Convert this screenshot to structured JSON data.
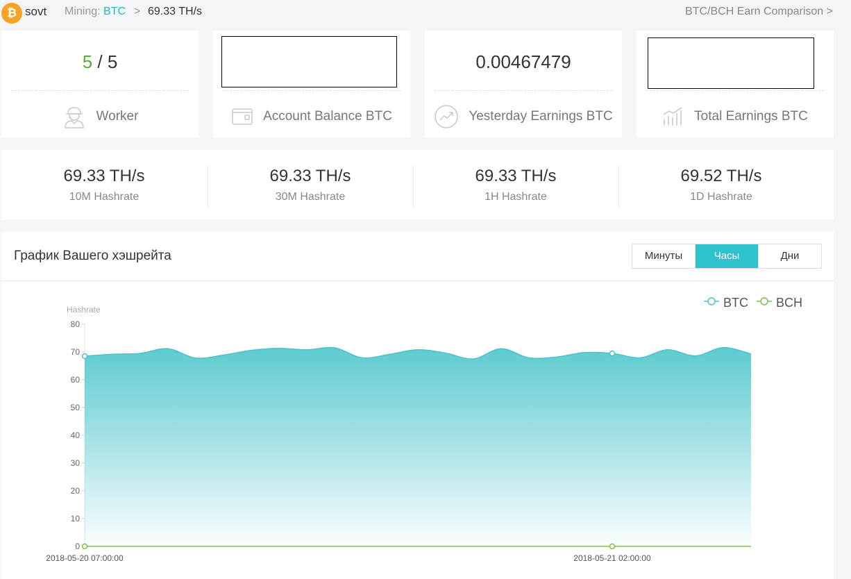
{
  "header": {
    "username": "sovt",
    "mining_label": "Mining: ",
    "coin": "BTC",
    "separator": ">",
    "current_rate": "69.33 TH/s",
    "compare_link": "BTC/BCH Earn Comparison >"
  },
  "cards": {
    "worker": {
      "active": "5",
      "sep": " / ",
      "total": "5",
      "label": "Worker",
      "icon": "worker-icon"
    },
    "balance": {
      "label": "Account Balance BTC",
      "icon": "wallet-icon"
    },
    "yesterday": {
      "value": "0.00467479",
      "label": "Yesterday Earnings BTC",
      "icon": "trend-icon"
    },
    "total": {
      "label": "Total Earnings BTC",
      "icon": "bar-chart-icon"
    }
  },
  "hashrates": [
    {
      "value": "69.33 TH/s",
      "label": "10M Hashrate"
    },
    {
      "value": "69.33 TH/s",
      "label": "30M Hashrate"
    },
    {
      "value": "69.33 TH/s",
      "label": "1H Hashrate"
    },
    {
      "value": "69.52 TH/s",
      "label": "1D Hashrate"
    }
  ],
  "chart_panel": {
    "title": "График Вашего хэшрейта",
    "tabs": [
      {
        "label": "Минуты",
        "active": false
      },
      {
        "label": "Часы",
        "active": true
      },
      {
        "label": "Дни",
        "active": false
      }
    ]
  },
  "colors": {
    "accent": "#2fc1cc",
    "btc_series": "#4cc3cc",
    "bch_series": "#7cc242",
    "coin": "#f7a325"
  },
  "chart_data": {
    "type": "area",
    "ylabel": "Hashrate",
    "ylim": [
      0,
      80
    ],
    "yticks": [
      0,
      10,
      20,
      30,
      40,
      50,
      60,
      70,
      80
    ],
    "x_tick_labels": [
      "2018-05-20 07:00:00",
      "2018-05-21 02:00:00"
    ],
    "x_tick_index": [
      0,
      19
    ],
    "legend_position": "top-right",
    "grid": false,
    "series": [
      {
        "name": "BTC",
        "color": "#4cc3cc",
        "values": [
          68.5,
          69.2,
          69.5,
          71.2,
          67.8,
          68.9,
          70.6,
          71.3,
          70.8,
          71.5,
          67.9,
          69.2,
          70.8,
          69.6,
          67.5,
          71.2,
          67.9,
          68.2,
          69.8,
          69.5,
          67.9,
          70.8,
          68.6,
          71.6,
          69.3
        ]
      },
      {
        "name": "BCH",
        "color": "#7cc242",
        "values": [
          0,
          0,
          0,
          0,
          0,
          0,
          0,
          0,
          0,
          0,
          0,
          0,
          0,
          0,
          0,
          0,
          0,
          0,
          0,
          0,
          0,
          0,
          0,
          0,
          0
        ]
      }
    ]
  }
}
